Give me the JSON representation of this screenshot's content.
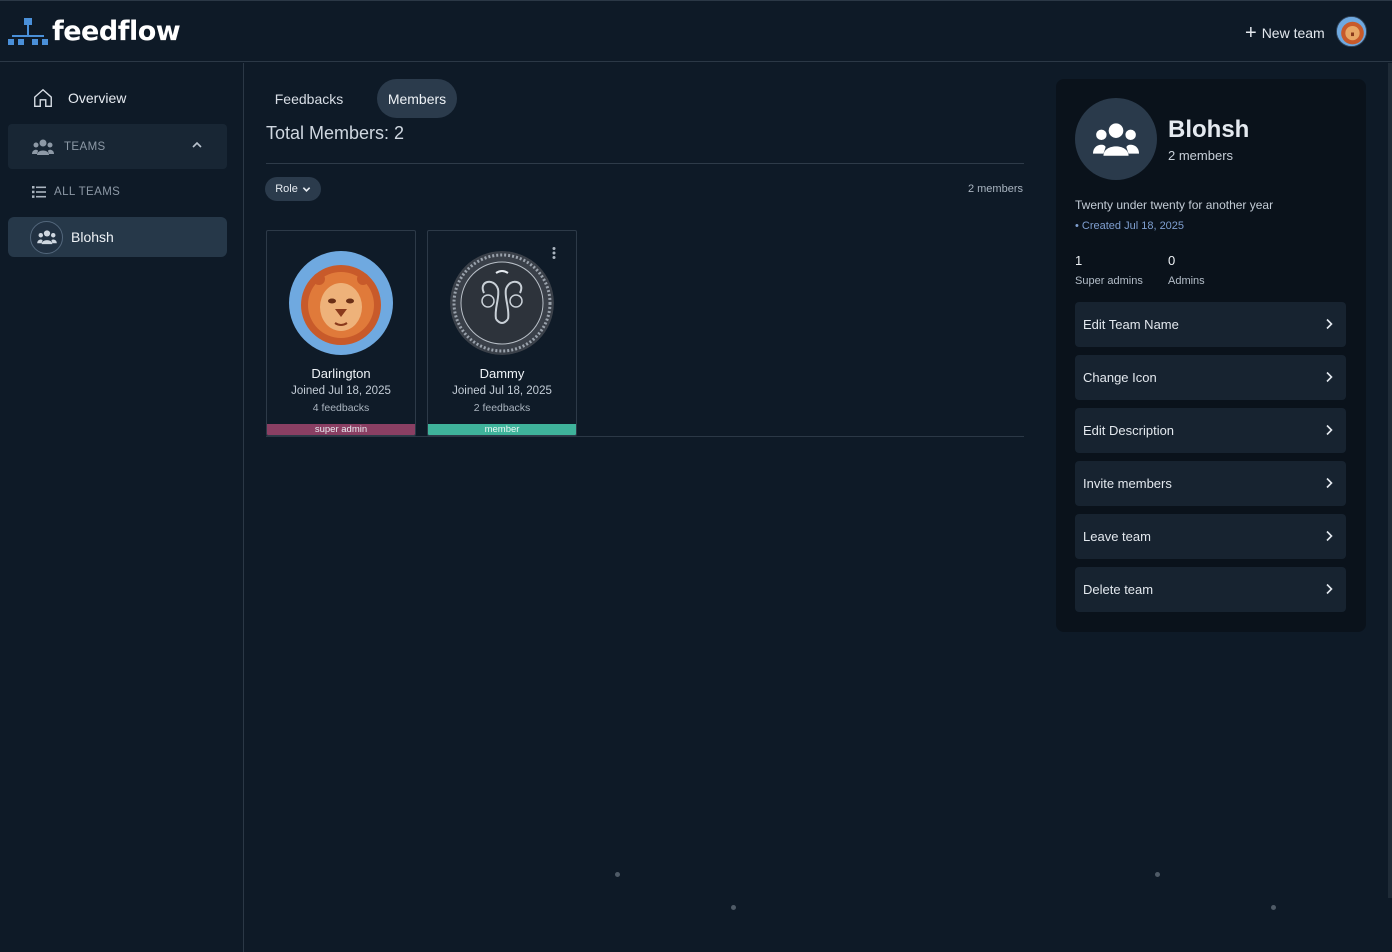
{
  "app": {
    "name": "feedflow"
  },
  "header": {
    "new_team_label": "New team",
    "avatar_icon": "lion-avatar"
  },
  "sidebar": {
    "overview_label": "Overview",
    "teams_label": "TEAMS",
    "all_teams_label": "ALL TEAMS",
    "teams": [
      {
        "label": "Blohsh"
      }
    ]
  },
  "main": {
    "tabs": [
      {
        "label": "Feedbacks",
        "active": false
      },
      {
        "label": "Members",
        "active": true
      }
    ],
    "total_members_label": "Total Members: 2",
    "role_filter_label": "Role",
    "members_count_label": "2 members",
    "members": [
      {
        "name": "Darlington",
        "joined": "Joined Jul 18, 2025",
        "feedbacks": "4 feedbacks",
        "role": "super admin",
        "avatar_icon": "lion-avatar",
        "role_color": "#8a3f63"
      },
      {
        "name": "Dammy",
        "joined": "Joined Jul 18, 2025",
        "feedbacks": "2 feedbacks",
        "role": "member",
        "avatar_icon": "aries-avatar",
        "role_color": "#3fb39b"
      }
    ]
  },
  "panel": {
    "team_name": "Blohsh",
    "members_label": "2 members",
    "description": "Twenty under twenty for another year",
    "created": "• Created Jul 18, 2025",
    "stats": [
      {
        "value": "1",
        "label": "Super admins"
      },
      {
        "value": "0",
        "label": "Admins"
      }
    ],
    "actions": [
      {
        "label": "Edit Team Name"
      },
      {
        "label": "Change Icon"
      },
      {
        "label": "Edit Description"
      },
      {
        "label": "Invite members"
      },
      {
        "label": "Leave team"
      },
      {
        "label": "Delete team"
      }
    ]
  },
  "colors": {
    "background": "#0e1a27",
    "panel": "#0a121b",
    "accent_blue": "#4a90d9",
    "active_tab": "#2b3b4c"
  }
}
